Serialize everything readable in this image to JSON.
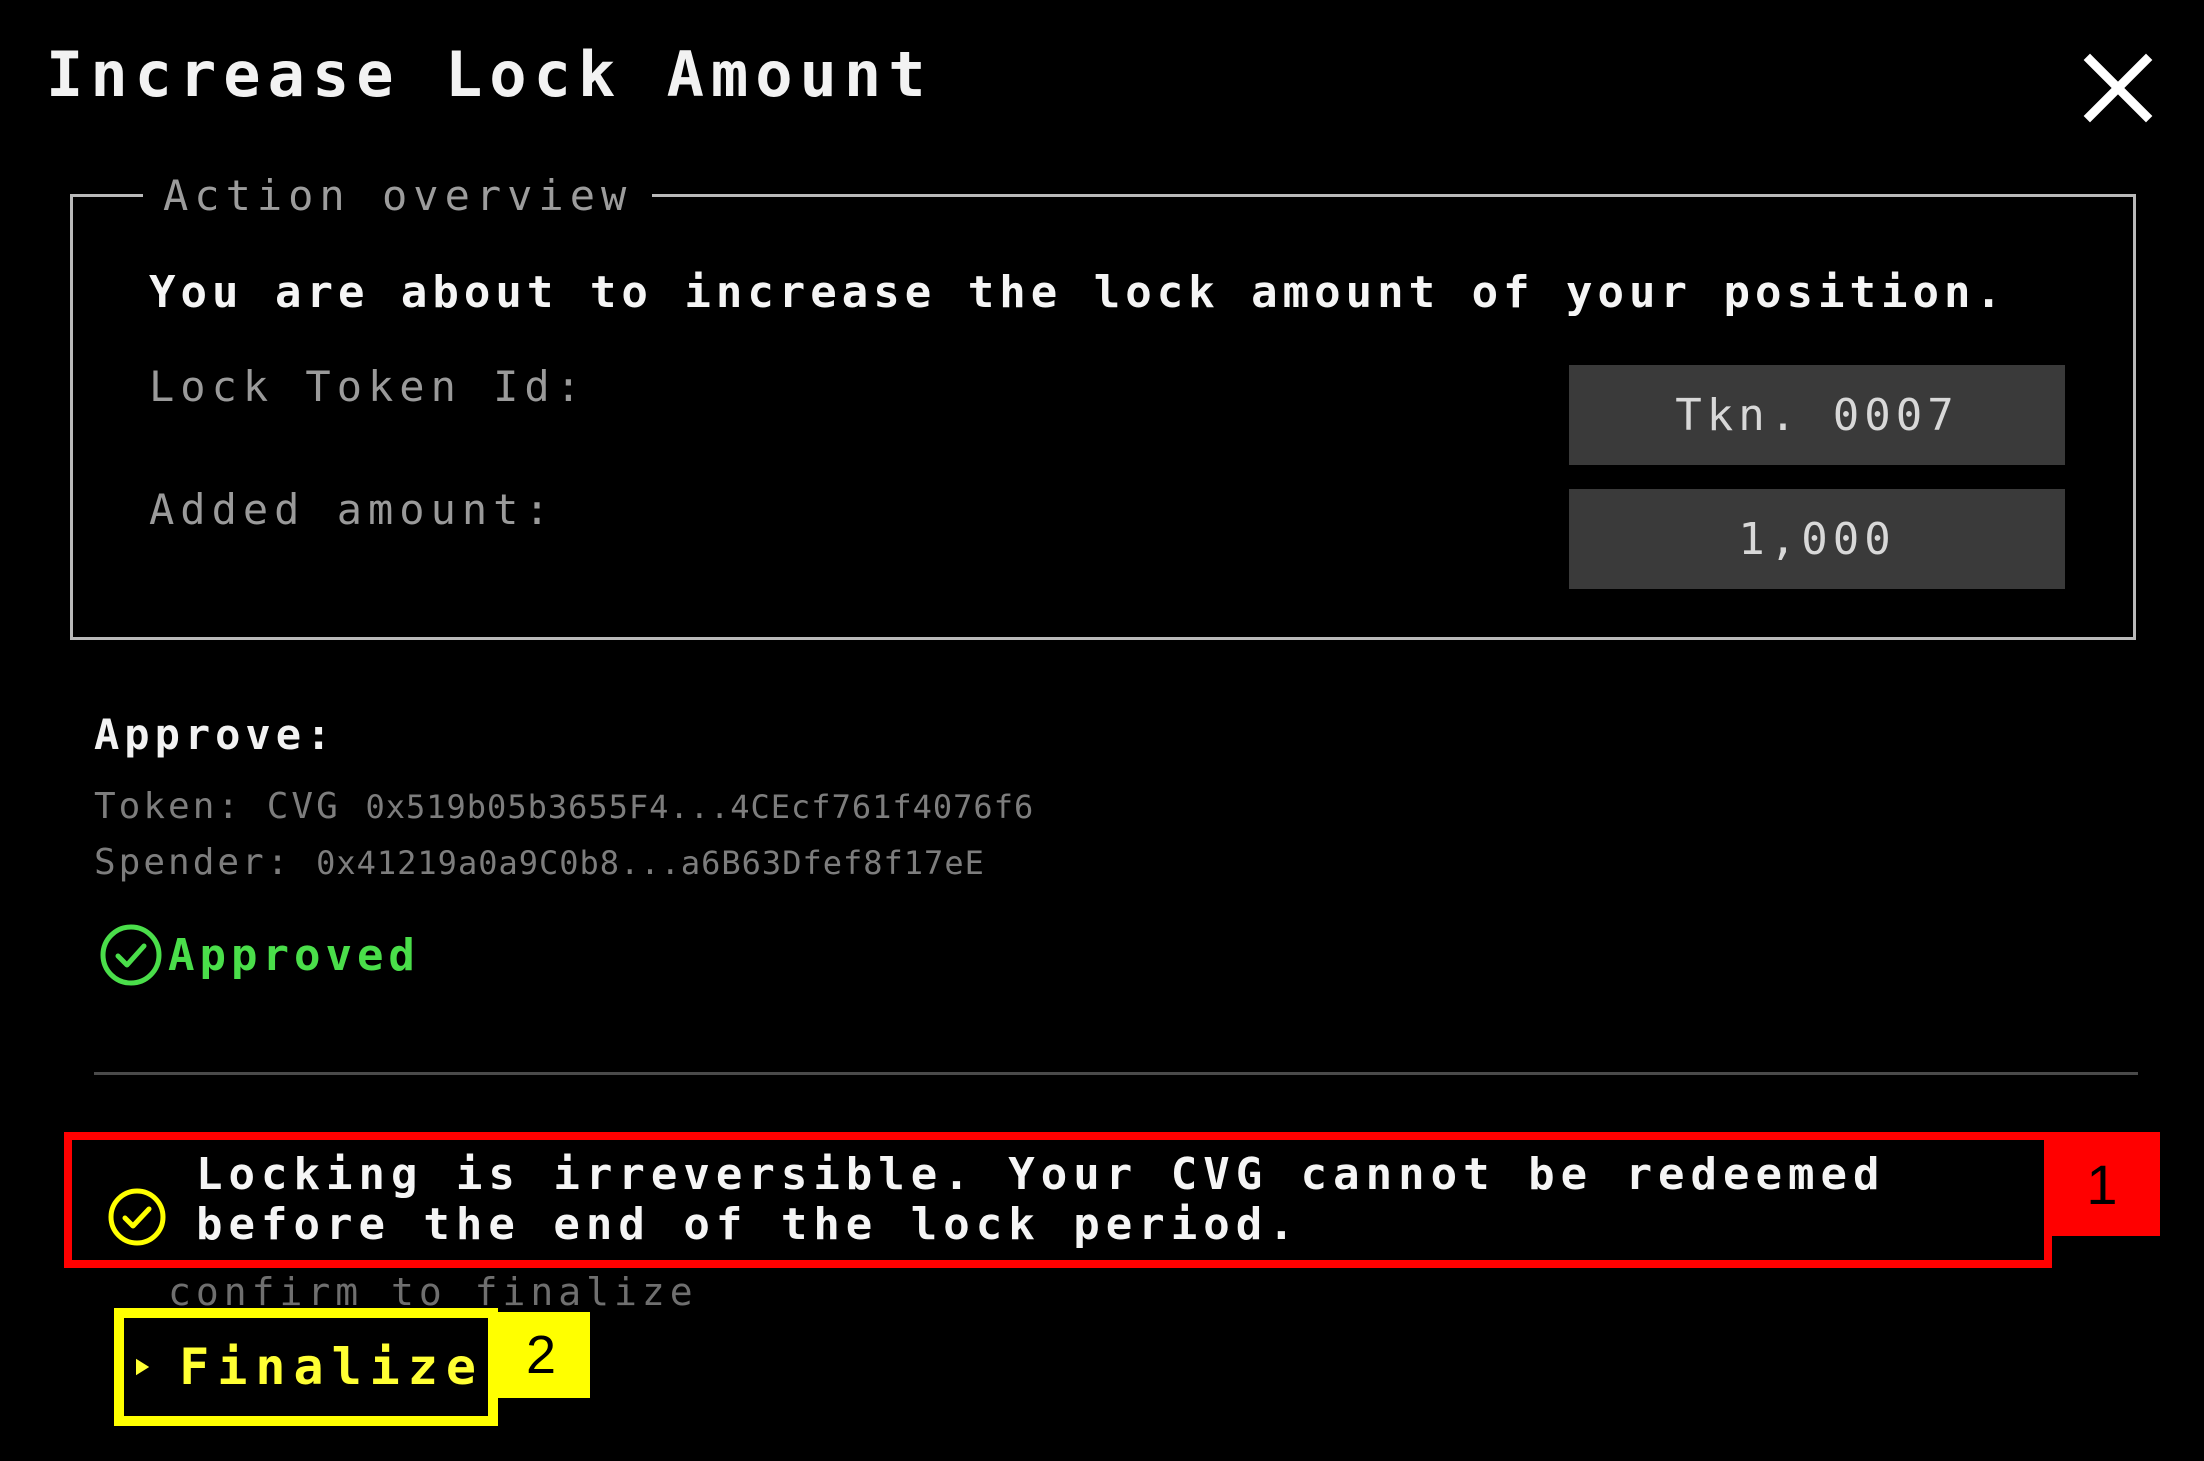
{
  "modal": {
    "title": "Increase Lock Amount",
    "close_icon": "close-icon"
  },
  "overview": {
    "legend": "Action overview",
    "description": "You are about to increase the lock amount of your position.",
    "token_label": "Lock Token Id:",
    "token_value": "Tkn. 0007",
    "amount_label": "Added amount:",
    "amount_value": "1,000"
  },
  "approve": {
    "title": "Approve:",
    "token_label": "Token:",
    "token_symbol": "CVG",
    "token_address": "0x519b05b3655F4...4CEcf761f4076f6",
    "spender_label": "Spender:",
    "spender_address": "0x41219a0a9C0b8...a6B63Dfef8f17eE",
    "status": "Approved",
    "status_icon": "check-circle-icon",
    "status_color": "#4ade4a"
  },
  "warning": {
    "icon": "check-circle-icon",
    "text": "Locking is irreversible. Your CVG cannot be redeemed before the end of the lock period.",
    "annotation": "1"
  },
  "finalize": {
    "hint": "confirm to finalize",
    "label": "Finalize",
    "icon": "play-arrow-icon",
    "annotation": "2"
  },
  "colors": {
    "background": "#000000",
    "highlight_red": "#ff0000",
    "highlight_yellow": "#ffff00",
    "value_box": "#3a3a3a",
    "finalize_text": "#ffff33"
  }
}
